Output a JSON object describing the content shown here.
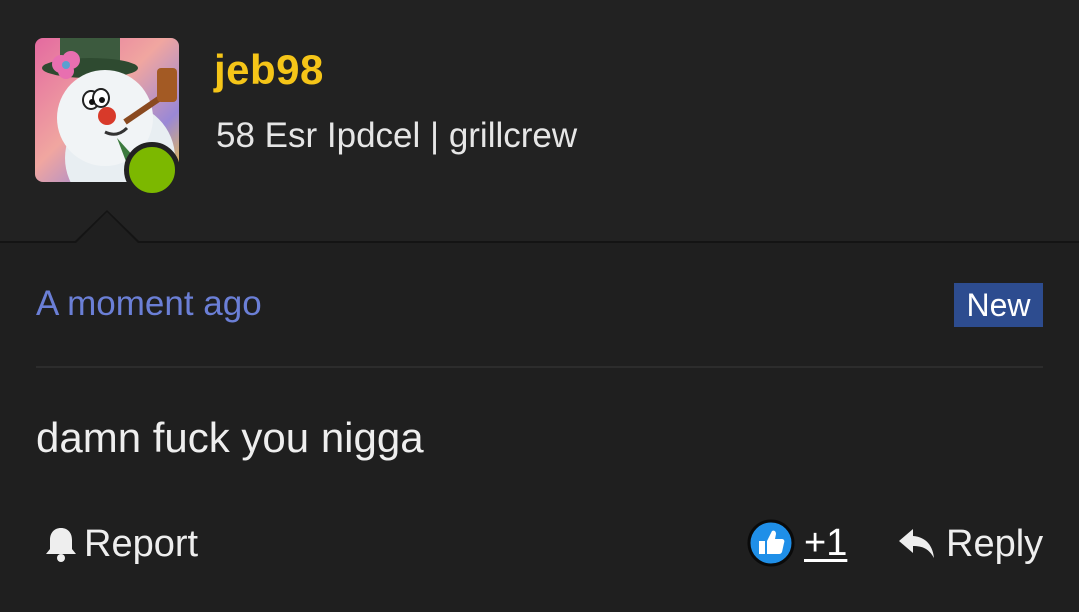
{
  "user": {
    "name": "jeb98",
    "title": "58 Esr Ipdcel | grillcrew",
    "online": true,
    "avatar_icon": "snowman-avatar"
  },
  "post": {
    "timestamp": "A moment ago",
    "badge": "New",
    "message": "damn fuck you nigga"
  },
  "actions": {
    "report_label": "Report",
    "like_count": "+1",
    "reply_label": "Reply"
  },
  "colors": {
    "username": "#f5c518",
    "timestamp": "#6b7fd6",
    "badge_bg": "#2d4c8f",
    "online": "#7cb800",
    "like_icon": "#1f8fe8"
  }
}
